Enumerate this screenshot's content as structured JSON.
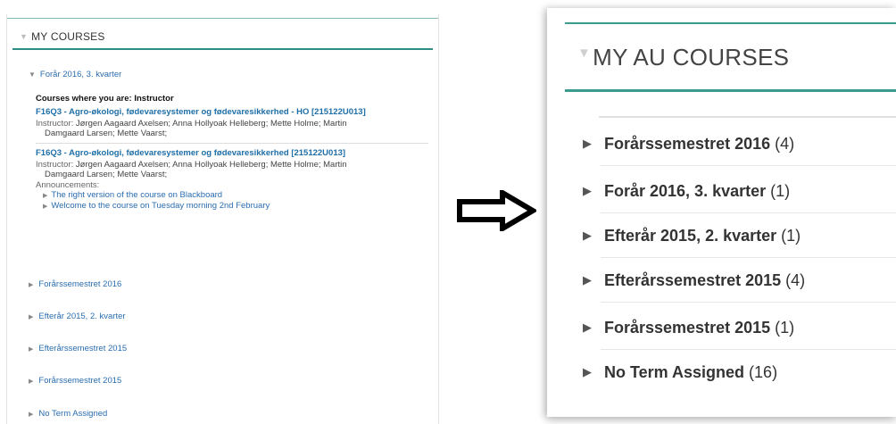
{
  "left_panel": {
    "title": "MY COURSES",
    "open_term": "Forår 2016, 3. kvarter",
    "role_heading": "Courses where you are: Instructor",
    "courses": [
      {
        "title": "F16Q3 - Agro-økologi, fødevaresystemer og fødevaresikkerhed - HO [215122U013]",
        "instructor_label": "Instructor:",
        "instructors_line1": "Jørgen Aagaard Axelsen;  Anna Hollyoak Helleberg;  Mette Holme;  Martin",
        "instructors_line2": "Damgaard Larsen;  Mette Vaarst;"
      },
      {
        "title": "F16Q3 - Agro-økologi, fødevaresystemer og fødevaresikkerhed [215122U013]",
        "instructor_label": "Instructor:",
        "instructors_line1": "Jørgen Aagaard Axelsen;  Anna Hollyoak Helleberg;  Mette Holme;  Martin",
        "instructors_line2": "Damgaard Larsen;  Mette Vaarst;",
        "announcements_label": "Announcements:",
        "announcements": [
          "The right version of the course on Blackboard",
          "Welcome to the course on Tuesday morning 2nd February"
        ]
      }
    ],
    "closed_terms": [
      "Forårssemestret 2016",
      "Efterår 2015, 2. kvarter",
      "Efterårssemestret 2015",
      "Forårssemestret 2015",
      "No Term Assigned"
    ]
  },
  "right_panel": {
    "title": "MY AU COURSES",
    "terms": [
      {
        "name": "Forårssemestret 2016",
        "count": "(4)"
      },
      {
        "name": "Forår 2016, 3. kvarter",
        "count": "(1)"
      },
      {
        "name": "Efterår 2015, 2. kvarter",
        "count": "(1)"
      },
      {
        "name": "Efterårssemestret 2015",
        "count": "(4)"
      },
      {
        "name": "Forårssemestret 2015",
        "count": "(1)"
      },
      {
        "name": "No Term Assigned",
        "count": "(16)"
      }
    ]
  },
  "icons": {
    "collapse": "triangle-down-icon",
    "expand": "triangle-right-icon",
    "arrow": "arrow-right-icon"
  },
  "colors": {
    "accent": "#2f8d83",
    "link": "#2a6db0",
    "course_link": "#1f6fa8"
  }
}
